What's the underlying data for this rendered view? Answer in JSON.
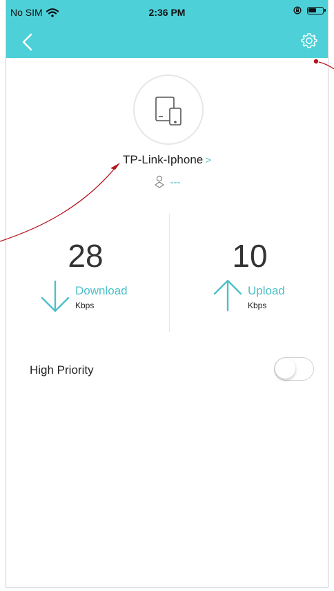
{
  "status_bar": {
    "carrier": "No SIM",
    "time": "2:36 PM"
  },
  "colors": {
    "header_bg": "#4dd0d8",
    "accent": "#4dbfc8",
    "annotation": "#b5121b"
  },
  "nav": {
    "back_icon": "chevron-left-icon",
    "settings_icon": "gear-icon"
  },
  "device": {
    "icon": "tablet-phone-icon",
    "name": "TP-Link-Iphone",
    "name_chevron": ">",
    "owner_icon": "owner-icon",
    "owner_value": "---"
  },
  "stats": {
    "download": {
      "value": "28",
      "label": "Download",
      "unit": "Kbps"
    },
    "upload": {
      "value": "10",
      "label": "Upload",
      "unit": "Kbps"
    }
  },
  "priority": {
    "label": "High Priority",
    "enabled": false
  }
}
